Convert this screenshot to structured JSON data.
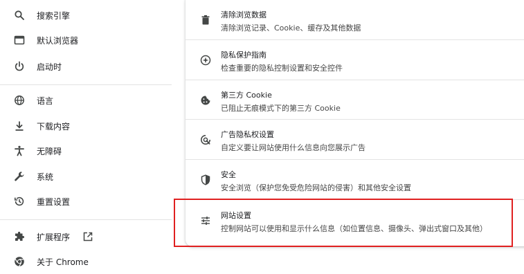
{
  "sidebar": {
    "items": [
      {
        "label": "搜索引擎",
        "icon": "search-icon"
      },
      {
        "label": "默认浏览器",
        "icon": "browser-window-icon"
      },
      {
        "label": "启动时",
        "icon": "power-icon"
      },
      {
        "label": "语言",
        "icon": "globe-icon"
      },
      {
        "label": "下载内容",
        "icon": "download-icon"
      },
      {
        "label": "无障碍",
        "icon": "accessibility-icon"
      },
      {
        "label": "系统",
        "icon": "wrench-icon"
      },
      {
        "label": "重置设置",
        "icon": "reset-history-icon"
      },
      {
        "label": "扩展程序",
        "icon": "puzzle-icon",
        "external_icon": "open-in-new-icon"
      },
      {
        "label": "关于 Chrome",
        "icon": "chrome-logo-icon"
      }
    ]
  },
  "privacy": {
    "rows": [
      {
        "title": "清除浏览数据",
        "subtitle": "清除浏览记录、Cookie、缓存及其他数据",
        "icon": "trash-icon"
      },
      {
        "title": "隐私保护指南",
        "subtitle": "检查重要的隐私控制设置和安全控件",
        "icon": "privacy-guide-icon"
      },
      {
        "title": "第三方 Cookie",
        "subtitle": "已阻止无痕模式下的第三方 Cookie",
        "icon": "cookie-icon"
      },
      {
        "title": "广告隐私权设置",
        "subtitle": "自定义要让网站使用什么信息向您展示广告",
        "icon": "ad-privacy-icon"
      },
      {
        "title": "安全",
        "subtitle": "安全浏览（保护您免受危险网站的侵害）和其他安全设置",
        "icon": "shield-icon"
      },
      {
        "title": "网站设置",
        "subtitle": "控制网站可以使用和显示什么信息（如位置信息、摄像头、弹出式窗口及其他）",
        "icon": "tune-sliders-icon"
      }
    ]
  },
  "colors": {
    "highlight_border": "#e02020",
    "icon": "#444746"
  }
}
